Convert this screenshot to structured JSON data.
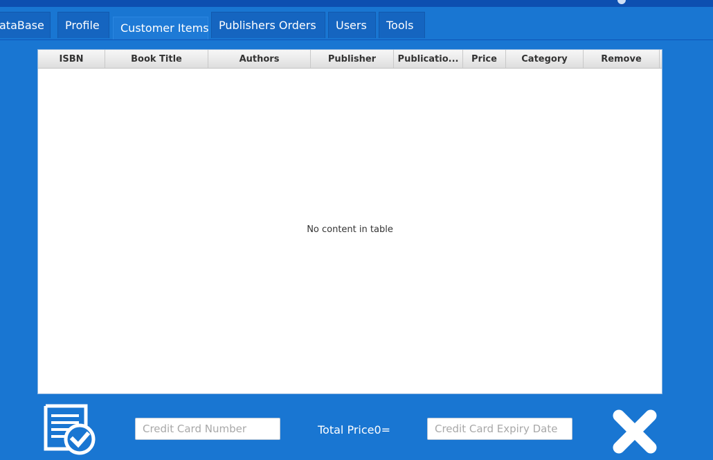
{
  "tabs": [
    {
      "label": "ataBase"
    },
    {
      "label": "Profile"
    },
    {
      "label": "Customer Items",
      "selected": true
    },
    {
      "label": "Publishers Orders"
    },
    {
      "label": "Users"
    },
    {
      "label": "Tools"
    }
  ],
  "table": {
    "columns": [
      "ISBN",
      "Book Title",
      "Authors",
      "Publisher",
      "Publicatio...",
      "Price",
      "Category",
      "Remove"
    ],
    "empty_message": "No content in table"
  },
  "checkout": {
    "icon": "checkout-document-check-icon",
    "card_number_placeholder": "Credit Card Number",
    "total_label": "Total Price",
    "total_value": "0",
    "total_suffix": "=",
    "expiry_placeholder": "Credit Card Expiry Date",
    "cancel_icon": "close-icon"
  },
  "colors": {
    "background": "#1976d2",
    "tab": "#1565c0",
    "tab_selected": "#1e7ad6",
    "header_bar": "#0d4fb0"
  }
}
